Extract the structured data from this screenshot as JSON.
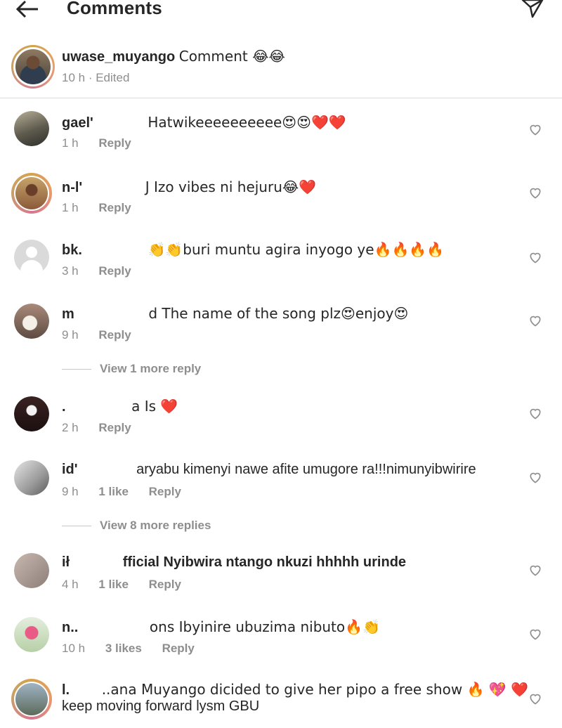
{
  "header": {
    "title": "Comments",
    "back_icon": "arrow-left-icon",
    "send_icon": "paper-plane-icon"
  },
  "caption": {
    "username": "uwase_muyango",
    "text": "Comment 😂😂",
    "time": "10 h",
    "edited": "· Edited"
  },
  "comments": [
    {
      "user": "gael'",
      "text": "Hatwikeeeeeeeeee😍😍❤️❤️",
      "time": "1 h",
      "likes": "",
      "reply": "Reply"
    },
    {
      "user": "n-l'",
      "text": "J Izo vibes ni hejuru😂❤️",
      "time": "1 h",
      "likes": "",
      "reply": "Reply"
    },
    {
      "user": "bk.",
      "text": "👏👏buri muntu agira inyogo ye🔥🔥🔥🔥",
      "time": "3 h",
      "likes": "",
      "reply": "Reply"
    },
    {
      "user": "m",
      "text": "d The name of the song plz😍enjoy😍",
      "time": "9 h",
      "likes": "",
      "reply": "Reply"
    },
    {
      "user": ".",
      "text": "a Is ❤️",
      "time": "2 h",
      "likes": "",
      "reply": "Reply"
    },
    {
      "user": "id'",
      "text": "aryabu kimenyi nawe afite umugore ra!!!nimunyibwirire",
      "time": "9 h",
      "likes": "1 like",
      "reply": "Reply"
    },
    {
      "user": "ił",
      "text": "fficial Nyibwira ntango nkuzi hhhhh urinde",
      "time": "4 h",
      "likes": "1 like",
      "reply": "Reply"
    },
    {
      "user": "n..",
      "text": "ons Ibyinire ubuzima nibuto🔥👏",
      "time": "10 h",
      "likes": "3 likes",
      "reply": "Reply"
    },
    {
      "user": "l.",
      "text": "..ana Muyango dicided to give her pipo a free show 🔥 💖 ❤️",
      "text2": "keep moving forward lysm GBU",
      "time": "",
      "likes": "",
      "reply": ""
    }
  ],
  "view_more": {
    "first": "View 1 more reply",
    "second": "View 8 more replies"
  },
  "colors": {
    "text": "#262626",
    "secondary": "#8e8e8e",
    "divider": "#dbdbdb",
    "heart_red": "#ed4956"
  }
}
